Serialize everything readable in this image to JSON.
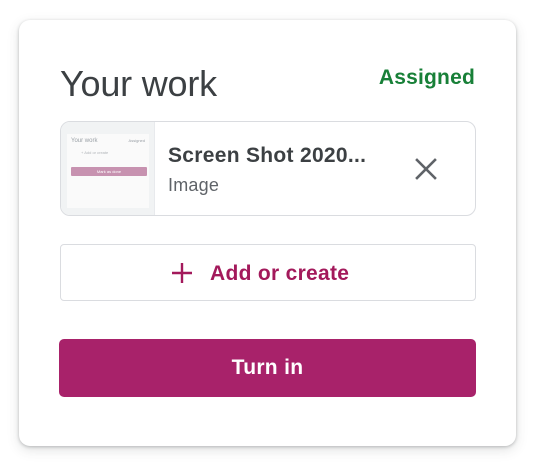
{
  "card": {
    "title": "Your work",
    "status": "Assigned",
    "status_color": "#188038",
    "accent_color": "#a8226a"
  },
  "attachment": {
    "name": "Screen Shot 2020...",
    "type": "Image",
    "thumbnail": {
      "title": "Your work",
      "status": "Assigned",
      "add_label": "+ Add or create",
      "button_label": "Mark as done"
    },
    "remove_icon": "close-icon"
  },
  "actions": {
    "add_icon": "plus-icon",
    "add_label": "Add or create",
    "turn_in_label": "Turn in"
  }
}
